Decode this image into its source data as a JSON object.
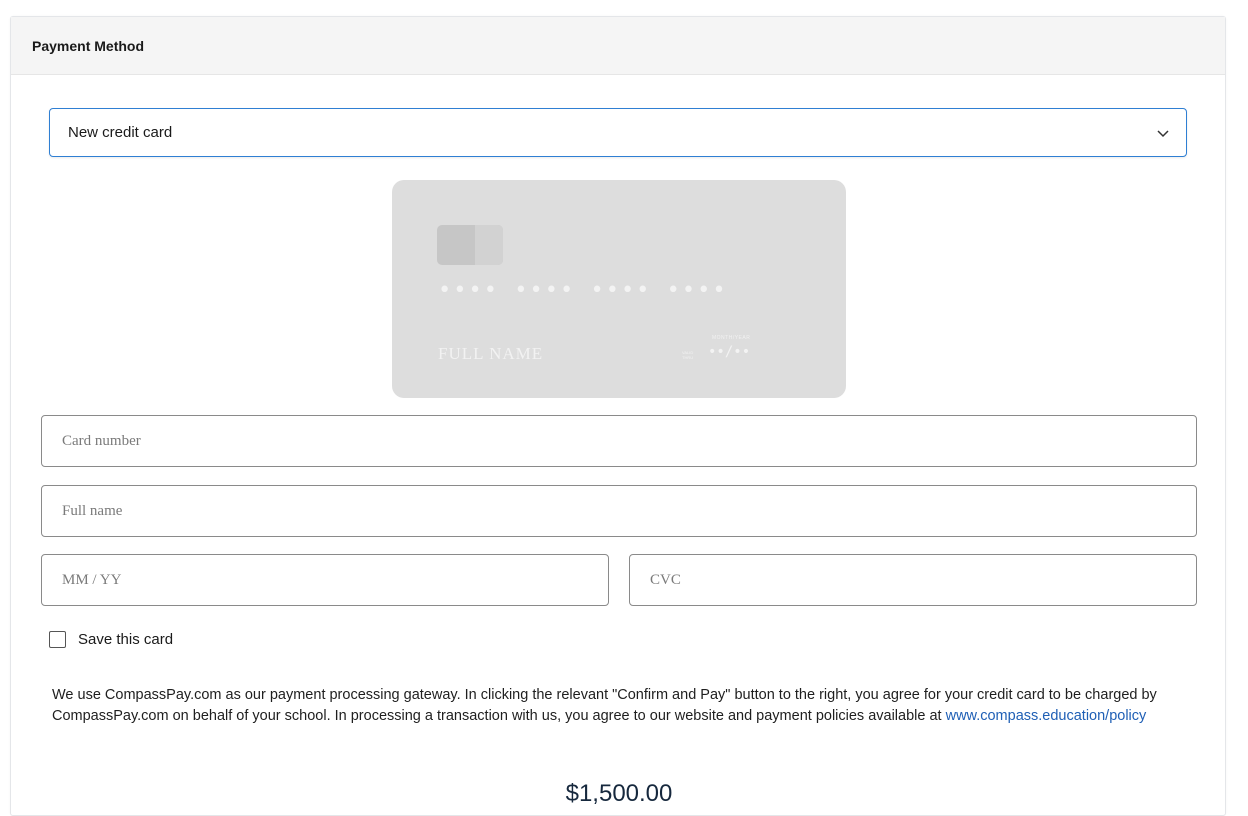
{
  "panel": {
    "title": "Payment Method"
  },
  "payment_select": {
    "selected": "New credit card",
    "icon": "chevron-down-icon"
  },
  "card_preview": {
    "number": "•••• •••• •••• ••••",
    "name": "FULL NAME",
    "valid_label": "VALID THRU",
    "month_year_label": "MONTH/YEAR",
    "expiry": "••/••"
  },
  "form": {
    "card_number_placeholder": "Card number",
    "full_name_placeholder": "Full name",
    "expiry_placeholder": "MM / YY",
    "cvc_placeholder": "CVC",
    "save_card_label": "Save this card"
  },
  "legal": {
    "text": "We use CompassPay.com as our payment processing gateway. In clicking the relevant \"Confirm and Pay\" button to the right, you agree for your credit card to be charged by CompassPay.com on behalf of your school. In processing a transaction with us, you agree to our website and payment policies available at ",
    "link_text": "www.compass.education/policy"
  },
  "amount": "$1,500.00",
  "colors": {
    "accent_border": "#2f7fd3",
    "link": "#1f5fb5",
    "amount": "#16283d"
  }
}
